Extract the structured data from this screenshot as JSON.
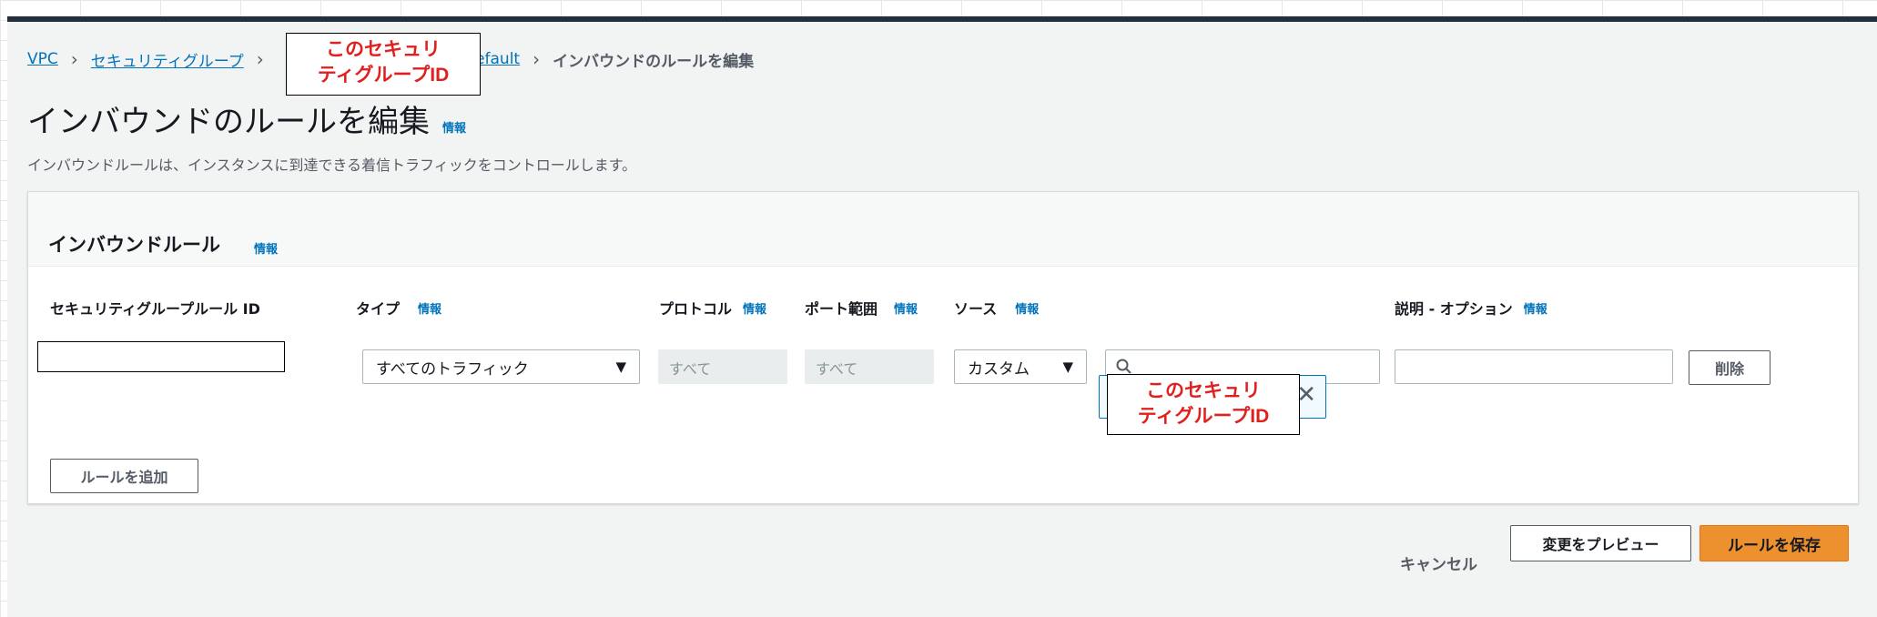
{
  "breadcrumb": {
    "vpc": "VPC",
    "security_groups": "セキュリティグループ",
    "sg_suffix": "- default",
    "current": "インバウンドのルールを編集"
  },
  "page": {
    "title": "インバウンドのルールを編集",
    "info": "情報",
    "description": "インバウンドルールは、インスタンスに到達できる着信トラフィックをコントロールします。"
  },
  "panel": {
    "title": "インバウンドルール",
    "info": "情報",
    "columns": {
      "rule_id": "セキュリティグループルール ID",
      "type": "タイプ",
      "protocol": "プロトコル",
      "port_range": "ポート範囲",
      "source": "ソース",
      "description": "説明 - オプション"
    },
    "row": {
      "type_value": "すべてのトラフィック",
      "protocol_value": "すべて",
      "port_value": "すべて",
      "source_value": "カスタム",
      "delete": "削除"
    },
    "add_rule": "ルールを追加"
  },
  "footer": {
    "cancel": "キャンセル",
    "preview": "変更をプレビュー",
    "save": "ルールを保存"
  },
  "annotations": {
    "sg_id_line1": "このセキュリ",
    "sg_id_line2": "ティグループID"
  },
  "colors": {
    "link": "#0073bb",
    "primary": "#ec912d",
    "topbar": "#232f3e",
    "annotation_text": "#e0201f"
  }
}
